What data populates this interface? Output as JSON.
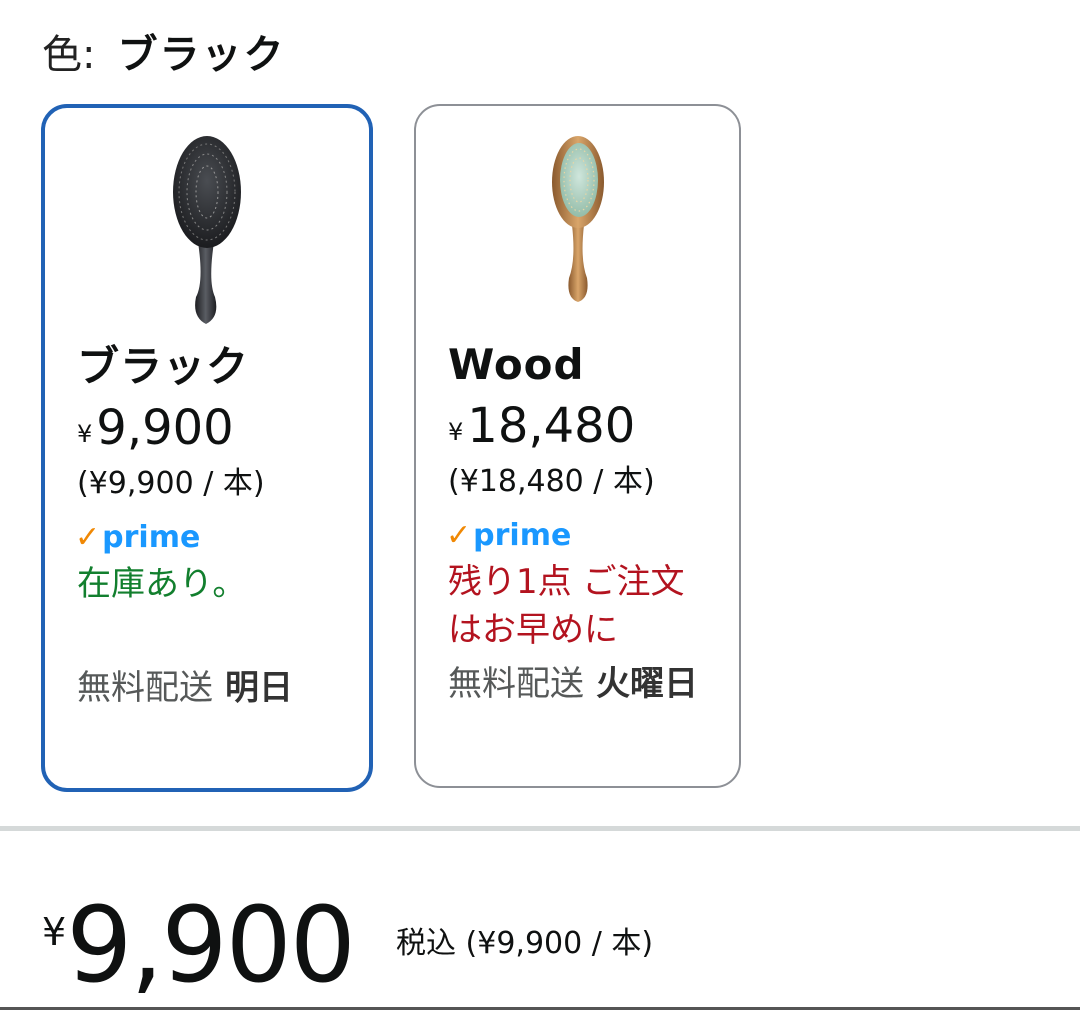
{
  "color_selector": {
    "label": "色:",
    "selected_value": "ブラック"
  },
  "swatches": [
    {
      "name": "ブラック",
      "currency": "¥",
      "price": "9,900",
      "unit_price": "(¥9,900 / 本)",
      "prime_label": "prime",
      "stock_text": "在庫あり。",
      "shipping_label": "無料配送",
      "shipping_day": "明日",
      "selected": true,
      "image": "black-paddle-hairbrush"
    },
    {
      "name": "Wood",
      "currency": "¥",
      "price": "18,480",
      "unit_price": "(¥18,480 / 本)",
      "prime_label": "prime",
      "stock_text": "残り1点 ご注文はお早めに",
      "shipping_label": "無料配送",
      "shipping_day": "火曜日",
      "selected": false,
      "image": "wooden-hairbrush"
    }
  ],
  "summary": {
    "currency": "¥",
    "price": "9,900",
    "tax_text": "税込 (¥9,900 / 本)"
  },
  "colors": {
    "selected_border": "#2162b5",
    "in_stock": "#127f2e",
    "low_stock": "#b3131f",
    "prime_check": "#f08804",
    "prime_text": "#1a98ff"
  }
}
